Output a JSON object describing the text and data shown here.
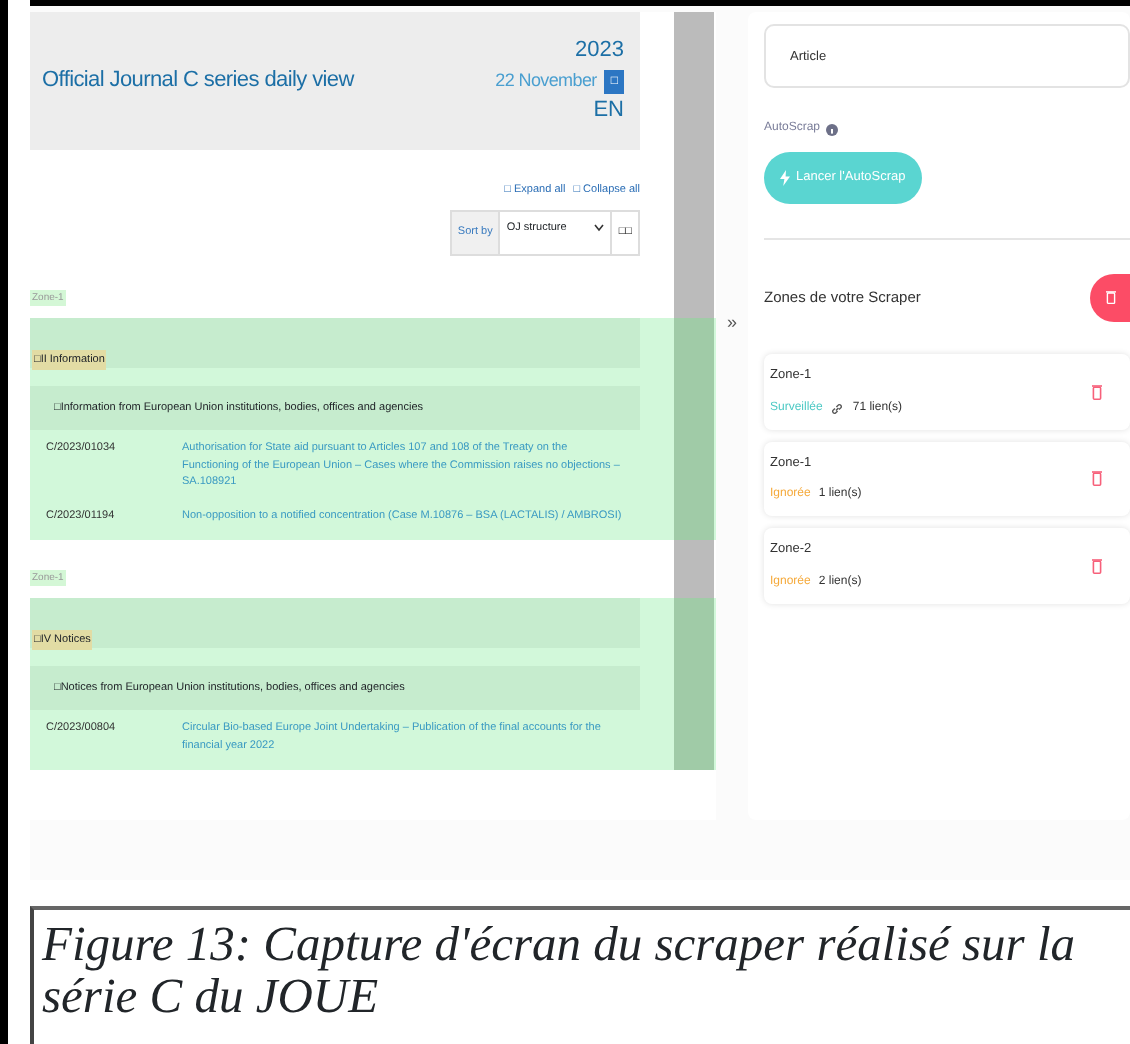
{
  "oj_view": {
    "title": "Official Journal C series daily view",
    "year": "2023",
    "date": "22 November",
    "date_button": "□",
    "language": "EN",
    "expand_all": "□ Expand all",
    "collapse_all": "□ Collapse all",
    "sort_label": "Sort by",
    "sort_value": "OJ structure",
    "view_toggle": "□□",
    "zones": [
      {
        "label": "Zone-1",
        "section": "□II Information",
        "subsection": "□Information from European Union institutions, bodies, offices and agencies",
        "rows": [
          {
            "number": "C/2023/01034",
            "title": "Authorisation for State aid pursuant to Articles 107 and 108 of the Treaty on the Functioning of the European Union – Cases where the Commission raises no objections – SA.108921"
          },
          {
            "number": "C/2023/01194",
            "title": "Non-opposition to a notified concentration (Case M.10876 – BSA (LACTALIS) / AMBROSI)"
          }
        ]
      },
      {
        "label": "Zone-1",
        "section": "□IV Notices",
        "subsection": "□Notices from European Union institutions, bodies, offices and agencies",
        "rows": [
          {
            "number": "C/2023/00804",
            "title": "Circular Bio-based Europe Joint Undertaking – Publication of the final accounts for the financial year 2022"
          }
        ]
      }
    ]
  },
  "scraper_panel": {
    "collapse_arrow": "»",
    "article_field": "Article",
    "autoscrap_label": "AutoScrap",
    "autoscrap_button": "Lancer l'AutoScrap",
    "zones_title": "Zones de votre Scraper",
    "zones": [
      {
        "name": "Zone-1",
        "status": "Surveillée",
        "color": "#4cc9c4",
        "link_icon": true,
        "links": "71 lien(s)"
      },
      {
        "name": "Zone-1",
        "status": "Ignorée",
        "color": "#f5a93a",
        "link_icon": false,
        "links": "1 lien(s)"
      },
      {
        "name": "Zone-2",
        "status": "Ignorée",
        "color": "#f5a93a",
        "link_icon": false,
        "links": "2 lien(s)"
      }
    ]
  },
  "caption": "Figure 13: Capture d'écran du scraper réalisé sur la série C du JOUE"
}
